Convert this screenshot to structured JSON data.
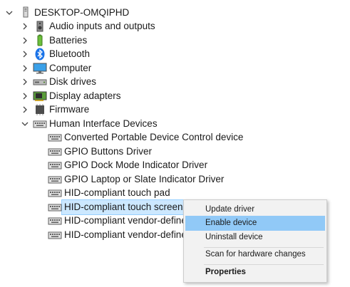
{
  "tree": {
    "root": "DESKTOP-OMQIPHD",
    "categories": [
      {
        "label": "Audio inputs and outputs",
        "icon": "speaker-icon"
      },
      {
        "label": "Batteries",
        "icon": "battery-icon"
      },
      {
        "label": "Bluetooth",
        "icon": "bluetooth-icon"
      },
      {
        "label": "Computer",
        "icon": "monitor-icon"
      },
      {
        "label": "Disk drives",
        "icon": "disk-drive-icon"
      },
      {
        "label": "Display adapters",
        "icon": "display-adapter-icon"
      },
      {
        "label": "Firmware",
        "icon": "firmware-icon"
      },
      {
        "label": "Human Interface Devices",
        "icon": "hid-icon"
      }
    ],
    "hid_children": [
      "Converted Portable Device Control device",
      "GPIO Buttons Driver",
      "GPIO Dock Mode Indicator Driver",
      "GPIO Laptop or Slate Indicator Driver",
      "HID-compliant touch pad",
      "HID-compliant touch screen",
      "HID-compliant vendor-define",
      "HID-compliant vendor-define"
    ]
  },
  "context_menu": {
    "items": [
      "Update driver",
      "Enable device",
      "Uninstall device",
      "Scan for hardware changes",
      "Properties"
    ]
  }
}
